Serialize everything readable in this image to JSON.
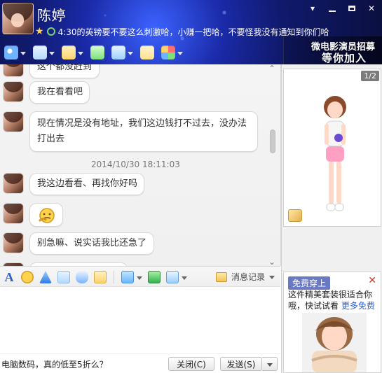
{
  "header": {
    "contact_name": "陈婷",
    "signature": "4:30的英镑要不要这么刺激哈，小赚一把哈，不要怪我没有通知到你们哈",
    "ad_line1": "微电影演员招募",
    "ad_line2": "等你加入",
    "window_controls": [
      "dropdown-icon",
      "minimize-icon",
      "maximize-icon",
      "close-icon"
    ]
  },
  "toolbar_icons": [
    {
      "name": "video-call-icon",
      "color": "#6fb4ff"
    },
    {
      "name": "voice-call-icon",
      "color": "#b6d9ff"
    },
    {
      "name": "transfer-file-icon",
      "color": "#ffd36a"
    },
    {
      "name": "create-discussion-icon",
      "color": "#7ee07a"
    },
    {
      "name": "remote-assist-icon",
      "color": "#9ad0ff"
    },
    {
      "name": "share-screen-icon",
      "color": "#ffe28a"
    },
    {
      "name": "apps-icon",
      "color": "#ff6f6f"
    }
  ],
  "chat": {
    "messages": [
      {
        "text": "这个都没赶到",
        "type": "single"
      },
      {
        "text": "我在看看吧",
        "type": "single"
      },
      {
        "text": "现在情况是没有地址，我们这边钱打不过去，没办法打出去",
        "type": "wrap"
      },
      {
        "text": "我这边看看、再找你好吗",
        "type": "single"
      },
      {
        "text": "",
        "type": "emoji"
      },
      {
        "text": "别急嘛、说实话我比还急了",
        "type": "single"
      }
    ],
    "timestamp": "2014/10/30 18:11:03"
  },
  "right_panel": {
    "page_indicator": "1/2",
    "promo": {
      "tag": "免费穿上",
      "text": "这件精美套装很适合你哦，快试试看",
      "link": "更多免费"
    }
  },
  "composer": {
    "history_label": "消息记录",
    "hint": "电脑数码，真的低至5折么？",
    "close_label": "关闭(C)",
    "send_label": "发送(S)"
  }
}
